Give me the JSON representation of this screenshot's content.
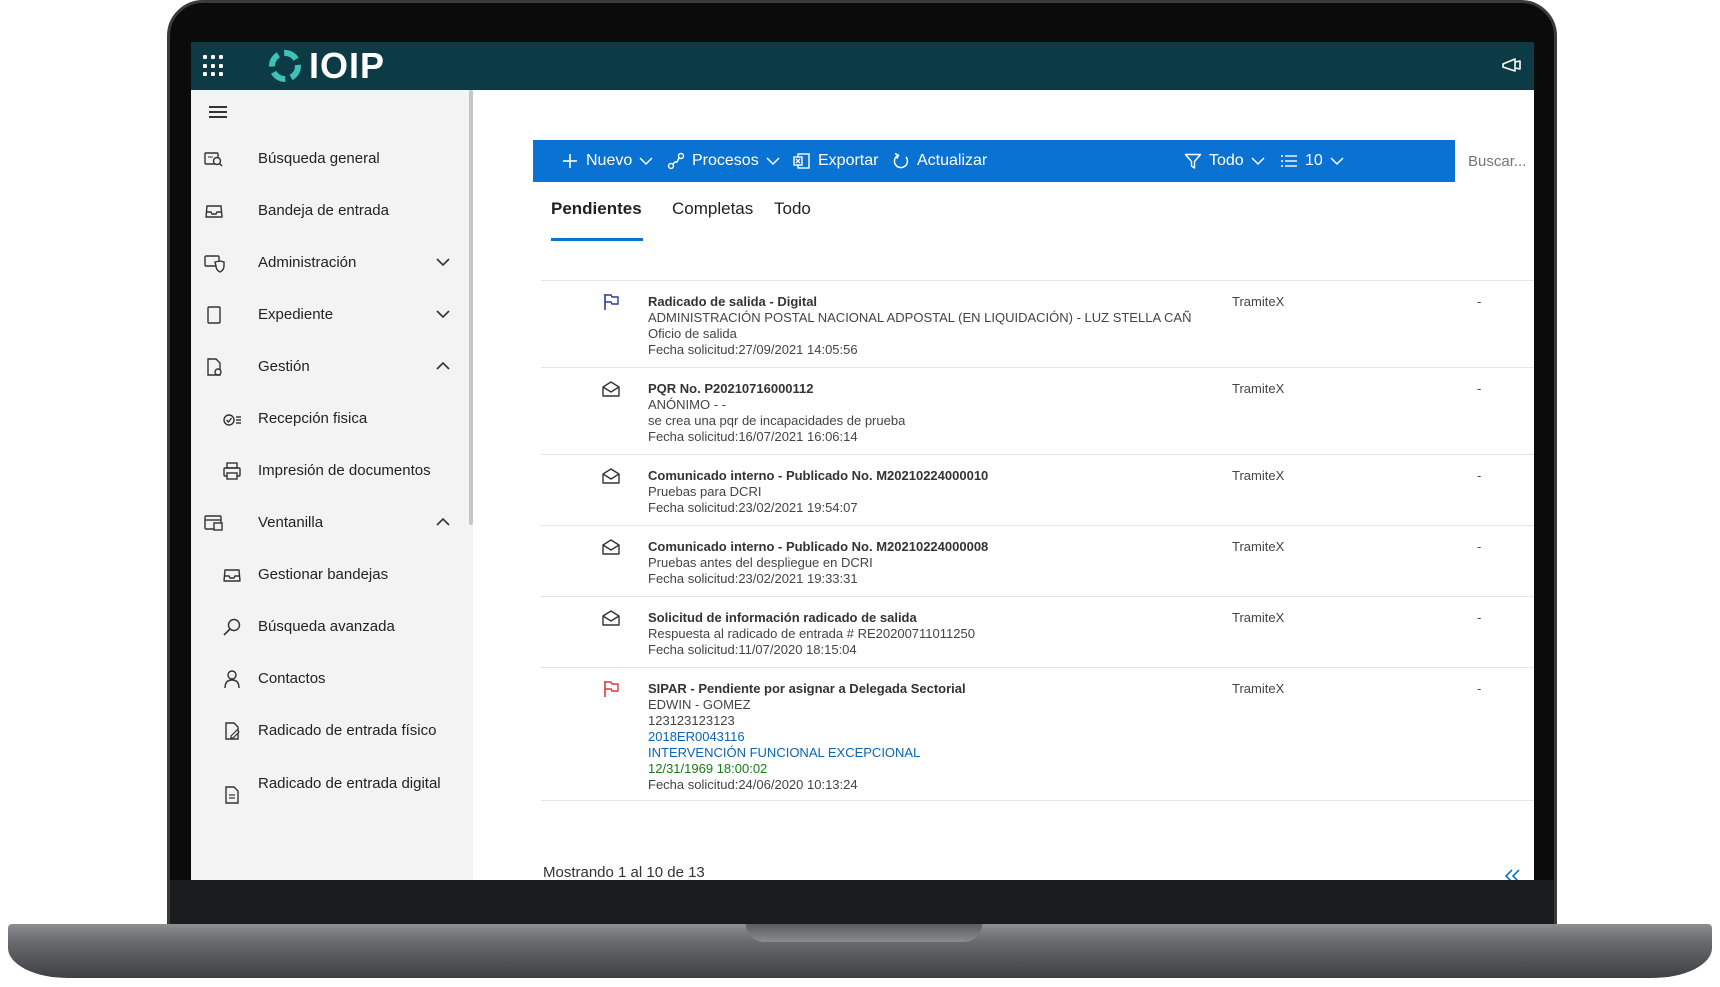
{
  "app": {
    "logo_text": "IOIP",
    "brand_color": "#0c3a45",
    "accent_color": "#0a72d3"
  },
  "topbar": {
    "waffle_icon": "app-launcher-icon",
    "megaphone_icon": "megaphone-icon"
  },
  "sidebar": {
    "items": [
      {
        "label": "Búsqueda general",
        "icon": "search-document-icon"
      },
      {
        "label": "Bandeja de entrada",
        "icon": "inbox-icon"
      },
      {
        "label": "Administración",
        "icon": "admin-shield-icon",
        "chevron": "down"
      },
      {
        "label": "Expediente",
        "icon": "folder-icon",
        "chevron": "down"
      },
      {
        "label": "Gestión",
        "icon": "document-gear-icon",
        "chevron": "up"
      },
      {
        "label": "Recepción fisica",
        "icon": "checklist-icon"
      },
      {
        "label": "Impresión de documentos",
        "icon": "printer-icon"
      },
      {
        "label": "Ventanilla",
        "icon": "window-icon",
        "chevron": "up"
      },
      {
        "label": "Gestionar bandejas",
        "icon": "inbox-icon"
      },
      {
        "label": "Búsqueda avanzada",
        "icon": "search-icon"
      },
      {
        "label": "Contactos",
        "icon": "person-icon"
      },
      {
        "label": "Radicado de entrada físico",
        "icon": "document-edit-icon"
      },
      {
        "label": "Radicado de entrada digital",
        "icon": "document-text-icon"
      }
    ]
  },
  "toolbar": {
    "new_label": "Nuevo",
    "processes_label": "Procesos",
    "export_label": "Exportar",
    "refresh_label": "Actualizar",
    "filter_label": "Todo",
    "page_size_label": "10",
    "search_placeholder": "Buscar..."
  },
  "tabs": [
    {
      "label": "Pendientes",
      "active": true
    },
    {
      "label": "Completas",
      "active": false
    },
    {
      "label": "Todo",
      "active": false
    }
  ],
  "items": [
    {
      "icon": "flag-icon",
      "icon_color": "#2b3a9e",
      "title": "Radicado de salida - Digital",
      "lines": [
        {
          "text": "ADMINISTRACIÓN POSTAL NACIONAL ADPOSTAL (EN LIQUIDACIÓN) - LUZ STELLA CAÑ",
          "style": "normal"
        },
        {
          "text": "Oficio de salida",
          "style": "normal"
        },
        {
          "text": "Fecha solicitud:27/09/2021 14:05:56",
          "style": "normal"
        }
      ],
      "source": "TramiteX",
      "status": "-"
    },
    {
      "icon": "envelope-open-icon",
      "icon_color": "#333333",
      "title": "PQR No. P20210716000112",
      "lines": [
        {
          "text": "ANÓNIMO - -",
          "style": "normal"
        },
        {
          "text": "se crea una pqr de incapacidades de prueba",
          "style": "normal"
        },
        {
          "text": "Fecha solicitud:16/07/2021 16:06:14",
          "style": "normal"
        }
      ],
      "source": "TramiteX",
      "status": "-"
    },
    {
      "icon": "envelope-open-icon",
      "icon_color": "#333333",
      "title": "Comunicado interno - Publicado No. M20210224000010",
      "lines": [
        {
          "text": "Pruebas para DCRI",
          "style": "normal"
        },
        {
          "text": "Fecha solicitud:23/02/2021 19:54:07",
          "style": "normal"
        }
      ],
      "source": "TramiteX",
      "status": "-"
    },
    {
      "icon": "envelope-open-icon",
      "icon_color": "#333333",
      "title": "Comunicado interno - Publicado No. M20210224000008",
      "lines": [
        {
          "text": "Pruebas antes del despliegue en DCRI",
          "style": "normal"
        },
        {
          "text": "Fecha solicitud:23/02/2021 19:33:31",
          "style": "normal"
        }
      ],
      "source": "TramiteX",
      "status": "-"
    },
    {
      "icon": "envelope-open-icon",
      "icon_color": "#333333",
      "title": "Solicitud de información radicado de salida",
      "lines": [
        {
          "text": "Respuesta al radicado de entrada # RE20200711011250",
          "style": "normal"
        },
        {
          "text": "Fecha solicitud:11/07/2020 18:15:04",
          "style": "normal"
        }
      ],
      "source": "TramiteX",
      "status": "-"
    },
    {
      "icon": "flag-icon",
      "icon_color": "#d83b3b",
      "title": "SIPAR - Pendiente por asignar a Delegada Sectorial",
      "lines": [
        {
          "text": "EDWIN - GOMEZ",
          "style": "normal"
        },
        {
          "text": "123123123123",
          "style": "normal"
        },
        {
          "text": "2018ER0043116",
          "style": "blue"
        },
        {
          "text": "INTERVENCIÓN FUNCIONAL EXCEPCIONAL",
          "style": "blue"
        },
        {
          "text": "12/31/1969 18:00:02",
          "style": "green"
        },
        {
          "text": "Fecha solicitud:24/06/2020 10:13:24",
          "style": "normal"
        }
      ],
      "source": "TramiteX",
      "status": "-"
    }
  ],
  "footer": {
    "summary": "Mostrando 1 al 10 de 13",
    "first_page_icon": "double-chevron-left-icon"
  }
}
